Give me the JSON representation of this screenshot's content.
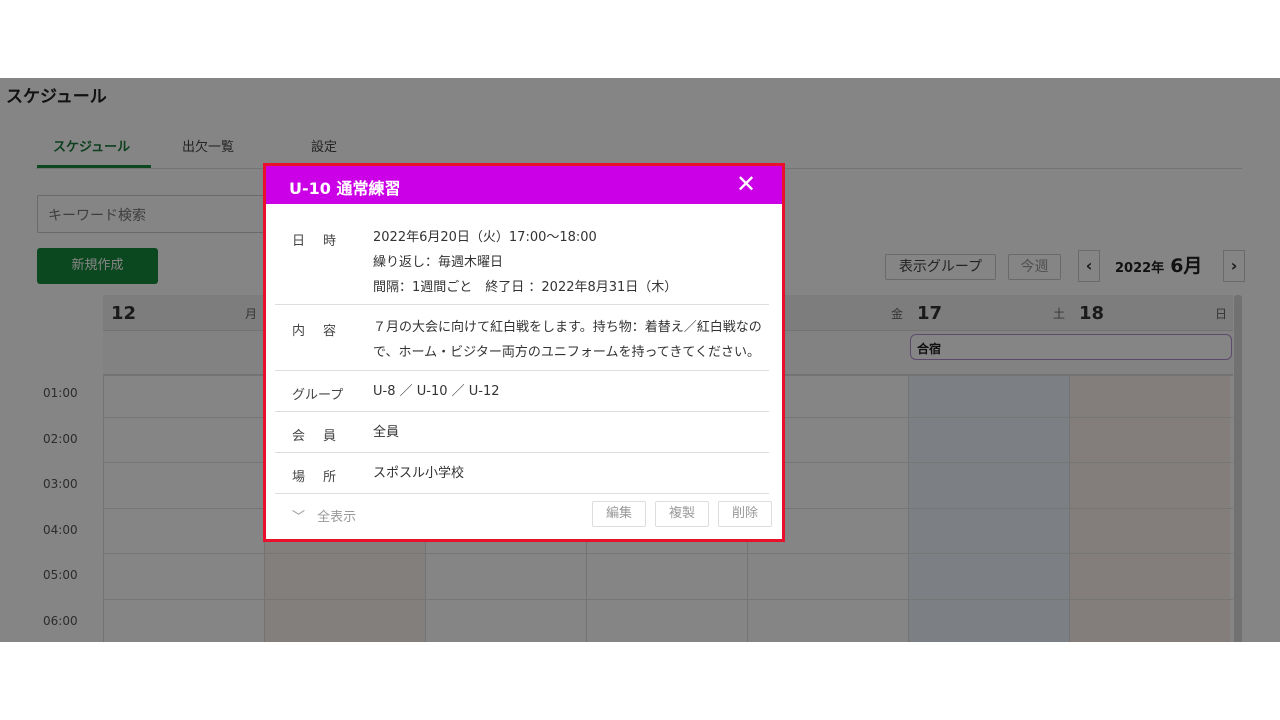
{
  "page": {
    "title": "スケジュール"
  },
  "tabs": [
    {
      "label": "スケジュール"
    },
    {
      "label": "出欠一覧"
    },
    {
      "label": "設定"
    }
  ],
  "search": {
    "placeholder": "キーワード検索"
  },
  "actions": {
    "new_label": "新規作成"
  },
  "toolbar": {
    "group_label": "表示グループ",
    "this_week_label": "今週",
    "prev_icon": "chevron-left-icon",
    "next_icon": "chevron-right-icon",
    "year_label": "2022年",
    "month_label": "6月"
  },
  "calendar": {
    "days": [
      {
        "num": "12",
        "dow": "月"
      },
      {
        "num": "",
        "dow": ""
      },
      {
        "num": "",
        "dow": ""
      },
      {
        "num": "",
        "dow": ""
      },
      {
        "num": "",
        "dow": "金"
      },
      {
        "num": "17",
        "dow": "土"
      },
      {
        "num": "18",
        "dow": "日"
      }
    ],
    "allday_event": "合宿",
    "times": [
      "01:00",
      "02:00",
      "03:00",
      "04:00",
      "05:00",
      "06:00"
    ]
  },
  "modal": {
    "title": "U-10 通常練習",
    "close_icon": "close-icon",
    "header_color": "#cc00e6",
    "rows": {
      "datetime": {
        "label": "日時",
        "lines": [
          "2022年6月20日（火）17:00～18:00",
          "繰り返し：毎週木曜日",
          "間隔：1週間ごと　終了日 ：2022年8月31日（木）"
        ]
      },
      "content": {
        "label": "内容",
        "lines": [
          "７月の大会に向けて紅白戦をします。持ち物：着替え／紅白戦なの",
          "で、ホーム・ビジター両方のユニフォームを持ってきてください。"
        ]
      },
      "group": {
        "label": "グループ",
        "value": "U-8 ／ U-10 ／ U-12"
      },
      "members": {
        "label": "会員",
        "value": "全員"
      },
      "place": {
        "label": "場所",
        "value": "スポスル小学校"
      }
    },
    "footer": {
      "expand_icon": "chevron-down-icon",
      "expand_label": "全表示",
      "edit_label": "編集",
      "duplicate_label": "複製",
      "delete_label": "削除"
    }
  }
}
